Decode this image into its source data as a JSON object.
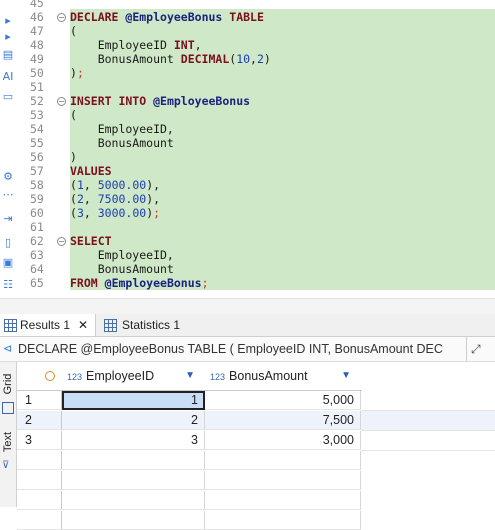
{
  "editor": {
    "lines": [
      {
        "num": "45",
        "fold": "",
        "html": ""
      },
      {
        "num": "46",
        "fold": "⊖",
        "html": "<span class='kw'>DECLARE</span> <span class='var'>@EmployeeBonus</span> <span class='kw'>TABLE</span>"
      },
      {
        "num": "47",
        "fold": "",
        "html": "("
      },
      {
        "num": "48",
        "fold": "",
        "html": "    EmployeeID <span class='kw'>INT</span>,"
      },
      {
        "num": "49",
        "fold": "",
        "html": "    BonusAmount <span class='kw'>DECIMAL</span>(<span class='num'>10</span>,<span class='num'>2</span>)"
      },
      {
        "num": "50",
        "fold": "",
        "html": ")<span class='red'>;</span>"
      },
      {
        "num": "51",
        "fold": "",
        "html": ""
      },
      {
        "num": "52",
        "fold": "⊖",
        "html": "<span class='kw'>INSERT INTO</span> <span class='var'>@EmployeeBonus</span>"
      },
      {
        "num": "53",
        "fold": "",
        "html": "("
      },
      {
        "num": "54",
        "fold": "",
        "html": "    EmployeeID,"
      },
      {
        "num": "55",
        "fold": "",
        "html": "    BonusAmount"
      },
      {
        "num": "56",
        "fold": "",
        "html": ")"
      },
      {
        "num": "57",
        "fold": "",
        "html": "<span class='kw'>VALUES</span>"
      },
      {
        "num": "58",
        "fold": "",
        "html": "(<span class='num'>1</span>, <span class='num'>5000.00</span>),"
      },
      {
        "num": "59",
        "fold": "",
        "html": "(<span class='num'>2</span>, <span class='num'>7500.00</span>),"
      },
      {
        "num": "60",
        "fold": "",
        "html": "(<span class='num'>3</span>, <span class='num'>3000.00</span>)<span class='red'>;</span>"
      },
      {
        "num": "61",
        "fold": "",
        "html": ""
      },
      {
        "num": "62",
        "fold": "⊖",
        "html": "<span class='kw'>SELECT</span>"
      },
      {
        "num": "63",
        "fold": "",
        "html": "    EmployeeID,"
      },
      {
        "num": "64",
        "fold": "",
        "html": "    BonusAmount"
      },
      {
        "num": "65",
        "fold": "",
        "html": "<span class='kw'>FROM</span> <span class='var'>@EmployeeBonus</span><span class='red'>;</span>"
      }
    ]
  },
  "tabs": {
    "results_label": "Results 1",
    "close_glyph": "✕",
    "statistics_label": "Statistics 1"
  },
  "query_bar": {
    "text": "DECLARE @EmployeeBonus TABLE ( EmployeeID INT, BonusAmount DEC"
  },
  "side_tabs": {
    "grid": "Grid",
    "text": "Text"
  },
  "grid": {
    "columns": [
      {
        "type_badge": "123",
        "label": "EmployeeID"
      },
      {
        "type_badge": "123",
        "label": "BonusAmount"
      }
    ],
    "rows": [
      {
        "num": "1",
        "employee_id": "1",
        "bonus": "5,000"
      },
      {
        "num": "2",
        "employee_id": "2",
        "bonus": "7,500"
      },
      {
        "num": "3",
        "employee_id": "3",
        "bonus": "3,000"
      }
    ]
  },
  "colors": {
    "keyword": "#7a0f1e",
    "variable": "#1a237e",
    "number": "#1a3fb0",
    "selection_bg": "#cfe8c8",
    "selected_cell": "#c9ddf6"
  }
}
